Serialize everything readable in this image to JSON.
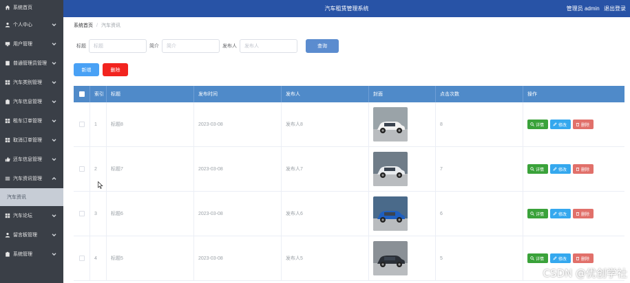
{
  "app": {
    "title": "汽车租赁管理系统",
    "user_role": "管理员 admin",
    "logout": "退出登录"
  },
  "sidebar": {
    "items": [
      {
        "label": "系统首页",
        "icon": "home-icon",
        "expandable": false
      },
      {
        "label": "个人中心",
        "icon": "user-icon",
        "expandable": true
      },
      {
        "label": "用户管理",
        "icon": "monitor-icon",
        "expandable": true
      },
      {
        "label": "普通管理员管理",
        "icon": "document-icon",
        "expandable": true
      },
      {
        "label": "汽车类别管理",
        "icon": "grid-icon",
        "expandable": true
      },
      {
        "label": "汽车信息管理",
        "icon": "clipboard-icon",
        "expandable": true
      },
      {
        "label": "租车订单管理",
        "icon": "grid-icon",
        "expandable": true
      },
      {
        "label": "取消订单管理",
        "icon": "grid-icon",
        "expandable": true
      },
      {
        "label": "还车信息管理",
        "icon": "thumb-icon",
        "expandable": true
      },
      {
        "label": "汽车资讯管理",
        "icon": "menu-icon",
        "expandable": true,
        "expanded": true
      }
    ],
    "subitem": {
      "label": "汽车资讯"
    },
    "items_after": [
      {
        "label": "汽车论坛",
        "icon": "grid-icon",
        "expandable": true
      },
      {
        "label": "留言板管理",
        "icon": "user-icon",
        "expandable": true
      },
      {
        "label": "系统管理",
        "icon": "clipboard-icon",
        "expandable": true
      }
    ]
  },
  "breadcrumb": {
    "home": "系统首页",
    "current": "汽车资讯"
  },
  "search": {
    "title_label": "标题",
    "title_placeholder": "标题",
    "intro_label": "简介",
    "intro_placeholder": "简介",
    "publisher_label": "发布人",
    "publisher_placeholder": "发布人",
    "query_button": "查询"
  },
  "actions": {
    "add": "新增",
    "delete": "删除"
  },
  "table": {
    "headers": {
      "index": "索引",
      "title": "标题",
      "time": "发布时间",
      "publisher": "发布人",
      "cover": "封面",
      "clicks": "点击次数",
      "ops": "操作"
    },
    "op_labels": {
      "detail": "详情",
      "edit": "修改",
      "delete": "删除"
    },
    "rows": [
      {
        "index": "1",
        "title": "标题8",
        "time": "2023-03-08",
        "publisher": "发布人8",
        "clicks": "8",
        "car_color": "#f2f2f2",
        "bg": "#9aa3a8"
      },
      {
        "index": "2",
        "title": "标题7",
        "time": "2023-03-08",
        "publisher": "发布人7",
        "clicks": "7",
        "car_color": "#e9ecef",
        "bg": "#6f7c88"
      },
      {
        "index": "3",
        "title": "标题6",
        "time": "2023-03-08",
        "publisher": "发布人6",
        "clicks": "6",
        "car_color": "#1f5fbf",
        "bg": "#4a6a8a"
      },
      {
        "index": "4",
        "title": "标题5",
        "time": "2023-03-08",
        "publisher": "发布人5",
        "clicks": "5",
        "car_color": "#2a2f36",
        "bg": "#8a9096"
      }
    ]
  },
  "watermark": "CSDN @优创学社",
  "colors": {
    "sidebar": "#3a3f47",
    "header": "#2853a6",
    "table_header": "#4f8ac9",
    "detail": "#3aa23a",
    "edit": "#35a8ee",
    "delete": "#e1706a",
    "add": "#49a1f5",
    "danger": "#f2241f"
  }
}
